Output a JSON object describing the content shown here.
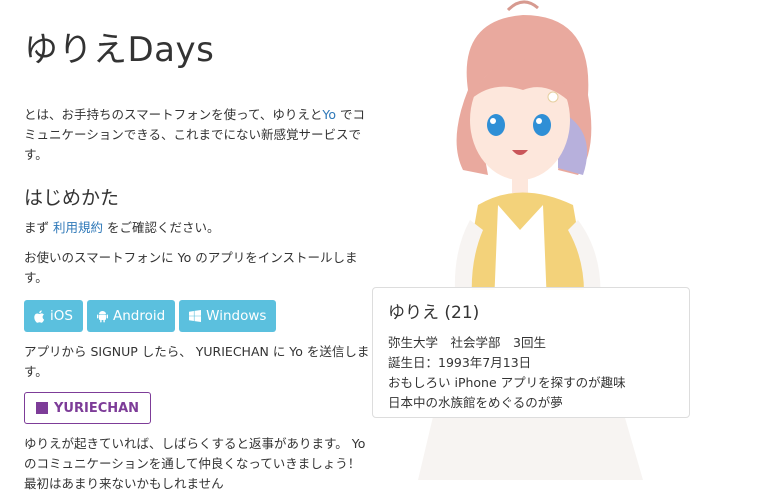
{
  "title": "ゆりえDays",
  "intro": {
    "part1": "とは、お手持ちのスマートフォンを使って、ゆりえと",
    "yo_link": "Yo",
    "part2": " でコミュニケーションできる、これまでにない新感覚サービスです。"
  },
  "howto": {
    "heading": "はじめかた",
    "terms_pre": "まず ",
    "terms_link": "利用規約",
    "terms_post": " をご確認ください。",
    "install_text": "お使いのスマートフォンに Yo のアプリをインストールします。",
    "buttons": [
      {
        "label": "iOS",
        "icon": "apple-icon"
      },
      {
        "label": "Android",
        "icon": "android-icon"
      },
      {
        "label": "Windows",
        "icon": "windows-icon"
      }
    ],
    "signup_text": "アプリから SIGNUP したら、 YURIECHAN に Yo を送信します。",
    "yuriechan_button": "YURIECHAN",
    "reply_text": "ゆりえが起きていれば、しばらくすると返事があります。 Yo のコミュニケーションを通して仲良くなっていきましょう！　最初はあまり来ないかもしれません"
  },
  "profile": {
    "name": "ゆりえ (21)",
    "lines": [
      "弥生大学　社会学部　3回生",
      "誕生日：1993年7月13日",
      "おもしろい iPhone アプリを探すのが趣味",
      "日本中の水族館をめぐるのが夢"
    ]
  },
  "colors": {
    "button_bg": "#5bc0de",
    "link": "#2e78b8",
    "yuriechan": "#7d3c98"
  }
}
